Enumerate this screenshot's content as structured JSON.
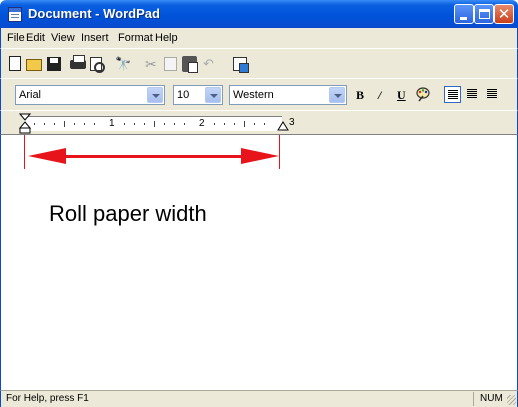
{
  "window": {
    "title": "Document - WordPad",
    "icons": {
      "app": "wordpad-icon",
      "minimize": "minimize-icon",
      "maximize": "maximize-icon",
      "close": "close-icon"
    },
    "close_glyph": "✕"
  },
  "menu": {
    "items": [
      "File",
      "Edit",
      "View",
      "Insert",
      "Format",
      "Help"
    ]
  },
  "toolbar": {
    "icons": [
      "new-document-icon",
      "open-folder-icon",
      "save-icon",
      "print-icon",
      "print-preview-icon",
      "find-icon",
      "cut-icon",
      "copy-icon",
      "paste-icon",
      "undo-icon",
      "insert-object-icon"
    ],
    "find_glyph": "🔭",
    "cut_glyph": "✂",
    "undo_glyph": "↶"
  },
  "format": {
    "font_name": "Arial",
    "font_size": "10",
    "script": "Western",
    "bold_label": "B",
    "italic_label": "/",
    "underline_label": "U",
    "icons": [
      "bold-icon",
      "italic-icon",
      "underline-icon",
      "color-palette-icon",
      "align-left-icon",
      "align-center-icon",
      "align-right-icon"
    ]
  },
  "ruler": {
    "numbers": [
      "1",
      "2",
      "3"
    ]
  },
  "document": {
    "annotation": "Roll paper width",
    "arrow_color": "#e8141c"
  },
  "status": {
    "help_text": "For Help, press F1",
    "num_indicator": "NUM"
  },
  "colors": {
    "titlebar": "#0053d8",
    "chrome": "#ece9d8",
    "annotation_red": "#e8141c"
  }
}
